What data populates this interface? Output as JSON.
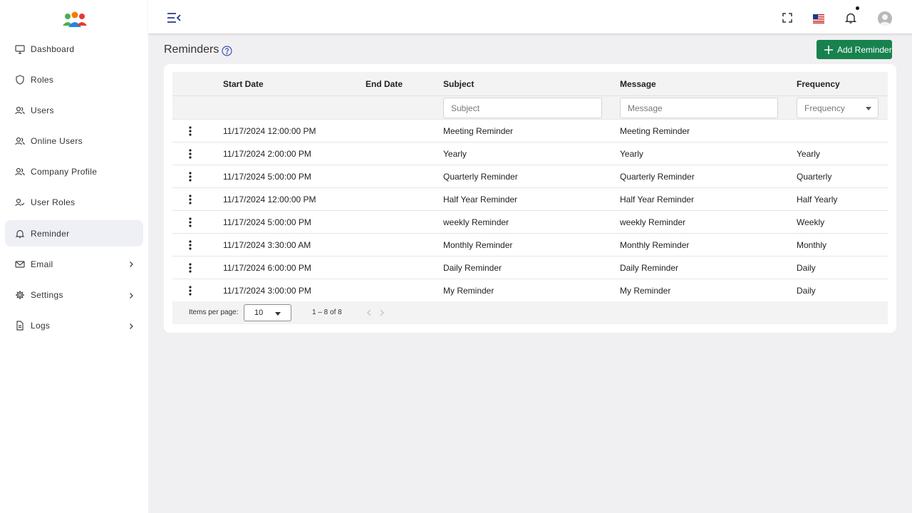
{
  "sidebar": {
    "items": [
      {
        "label": "Dashboard",
        "icon": "monitor-icon"
      },
      {
        "label": "Roles",
        "icon": "shield-icon"
      },
      {
        "label": "Users",
        "icon": "users-icon"
      },
      {
        "label": "Online Users",
        "icon": "users-icon"
      },
      {
        "label": "Company Profile",
        "icon": "users-icon"
      },
      {
        "label": "User Roles",
        "icon": "user-check-icon"
      },
      {
        "label": "Reminder",
        "icon": "bell-icon",
        "active": true
      },
      {
        "label": "Email",
        "icon": "mail-icon",
        "expandable": true
      },
      {
        "label": "Settings",
        "icon": "gear-icon",
        "expandable": true
      },
      {
        "label": "Logs",
        "icon": "file-icon",
        "expandable": true
      }
    ]
  },
  "header": {
    "icons": [
      "menu-toggle-icon",
      "fullscreen-icon",
      "us-flag-icon",
      "bell-icon",
      "avatar-icon"
    ]
  },
  "page": {
    "title": "Reminders",
    "add_button_label": "Add Reminder"
  },
  "table": {
    "columns": {
      "start": "Start Date",
      "end": "End Date",
      "subject": "Subject",
      "message": "Message",
      "frequency": "Frequency"
    },
    "filters": {
      "subject_placeholder": "Subject",
      "message_placeholder": "Message",
      "frequency_placeholder": "Frequency"
    },
    "rows": [
      {
        "start": "11/17/2024 12:00:00 PM",
        "end": "",
        "subject": "Meeting Reminder",
        "message": "Meeting Reminder",
        "frequency": ""
      },
      {
        "start": "11/17/2024 2:00:00 PM",
        "end": "",
        "subject": "Yearly",
        "message": "Yearly",
        "frequency": "Yearly"
      },
      {
        "start": "11/17/2024 5:00:00 PM",
        "end": "",
        "subject": "Quarterly Reminder",
        "message": "Quarterly Reminder",
        "frequency": "Quarterly"
      },
      {
        "start": "11/17/2024 12:00:00 PM",
        "end": "",
        "subject": "Half Year Reminder",
        "message": "Half Year Reminder",
        "frequency": "Half Yearly"
      },
      {
        "start": "11/17/2024 5:00:00 PM",
        "end": "",
        "subject": "weekly Reminder",
        "message": "weekly Reminder",
        "frequency": "Weekly"
      },
      {
        "start": "11/17/2024 3:30:00 AM",
        "end": "",
        "subject": "Monthly Reminder",
        "message": "Monthly Reminder",
        "frequency": "Monthly"
      },
      {
        "start": "11/17/2024 6:00:00 PM",
        "end": "",
        "subject": "Daily Reminder",
        "message": "Daily Reminder",
        "frequency": "Daily"
      },
      {
        "start": "11/17/2024 3:00:00 PM",
        "end": "",
        "subject": "My Reminder",
        "message": "My Reminder",
        "frequency": "Daily"
      }
    ]
  },
  "paginator": {
    "items_per_page_label": "Items per page:",
    "page_size": "10",
    "range_label": "1 – 8 of 8"
  },
  "colors": {
    "accent": "#17824e",
    "link": "#3f51b5",
    "active_nav_bg": "#eef0f6"
  }
}
